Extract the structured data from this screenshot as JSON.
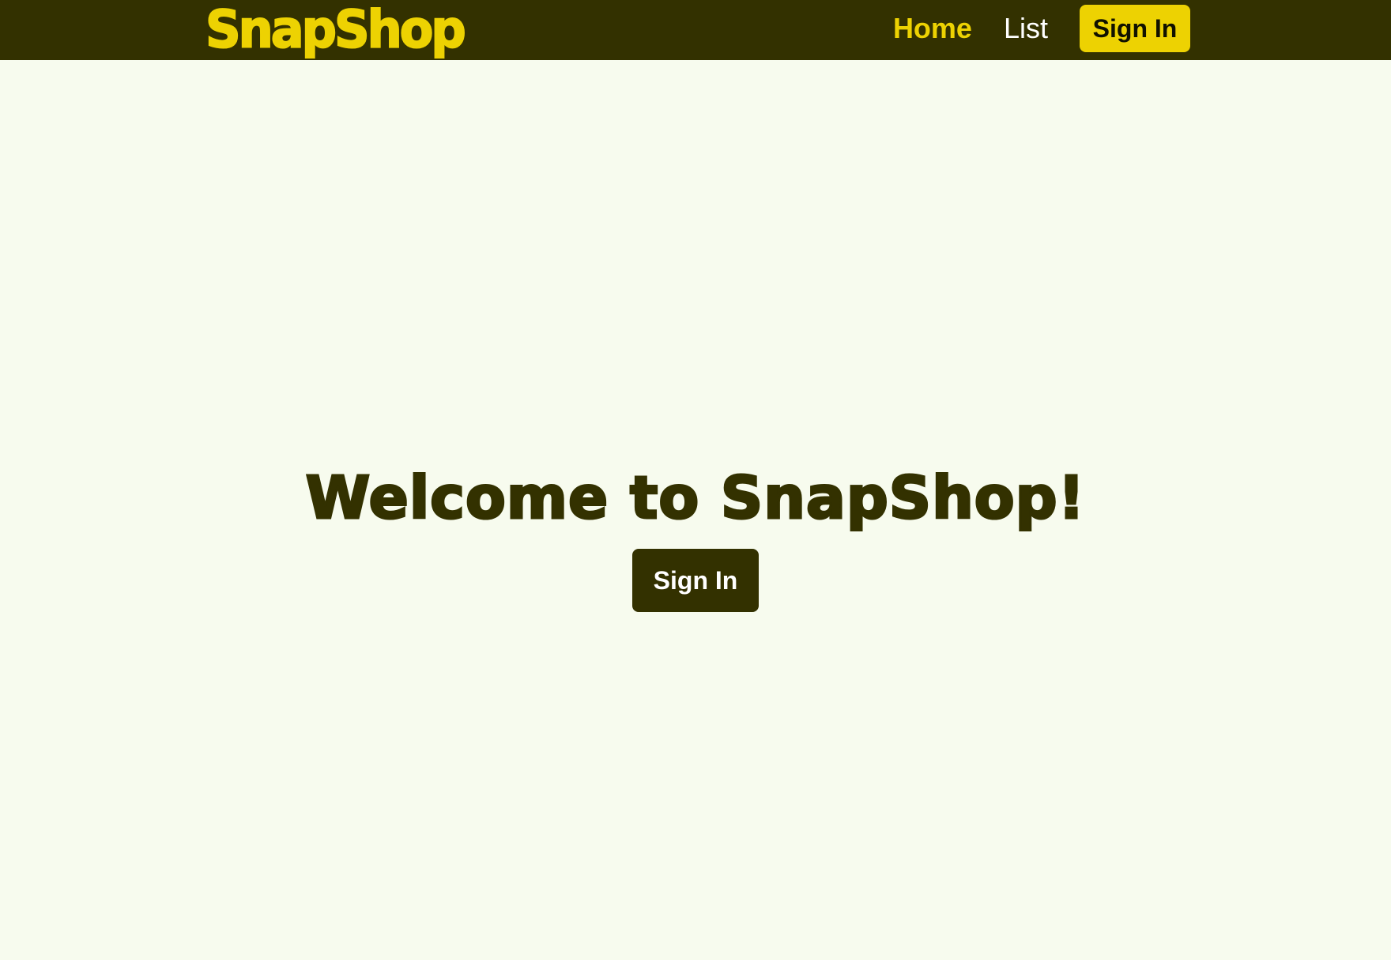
{
  "brand": {
    "name": "SnapShop",
    "color": "#edd202"
  },
  "nav": {
    "items": [
      {
        "label": "Home",
        "active": true
      },
      {
        "label": "List",
        "active": false
      }
    ],
    "signin_label": "Sign In"
  },
  "hero": {
    "title": "Welcome to SnapShop!",
    "signin_label": "Sign In"
  },
  "colors": {
    "navbar_bg": "#333100",
    "accent": "#edd202",
    "page_bg": "#f7fbee",
    "dark_text": "#333100"
  }
}
